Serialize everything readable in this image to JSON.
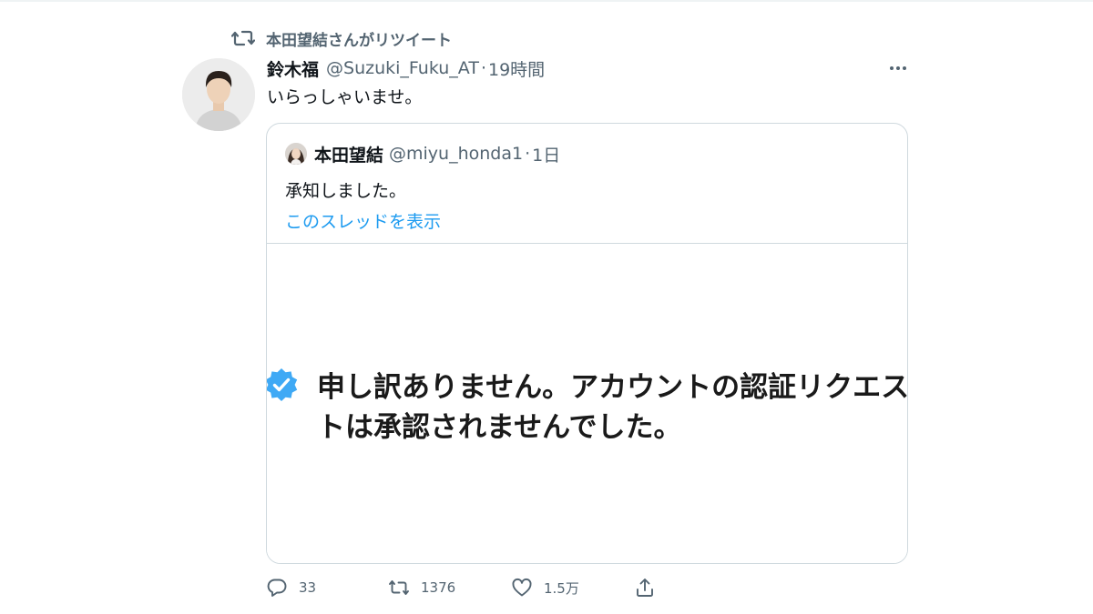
{
  "retweet_context": {
    "label": "本田望結さんがリツイート",
    "icon": "retweet-icon"
  },
  "tweet": {
    "author_name": "鈴木福",
    "author_handle": "@Suzuki_Fuku_AT",
    "separator": "·",
    "time": "19時間",
    "text": "いらっしゃいませ。",
    "more_icon": "more-dots-icon"
  },
  "quote": {
    "author_name": "本田望結",
    "author_handle": "@miyu_honda1",
    "separator": "·",
    "time": "1日",
    "text": "承知しました。",
    "show_thread": "このスレッドを表示",
    "media": {
      "line1": "申し訳ありません。アカウントの認証リクエス",
      "line2": "トは承認されませんでした。",
      "badge_icon": "verified-badge-icon"
    }
  },
  "actions": {
    "reply": {
      "icon": "reply-icon",
      "count": "33"
    },
    "retweet": {
      "icon": "retweet-icon",
      "count": "1376"
    },
    "like": {
      "icon": "heart-icon",
      "count": "1.5万"
    },
    "share": {
      "icon": "share-icon"
    }
  },
  "colors": {
    "accent": "#1d9bf0",
    "muted": "#536471",
    "text": "#0f1419",
    "border": "#cfd9de"
  }
}
